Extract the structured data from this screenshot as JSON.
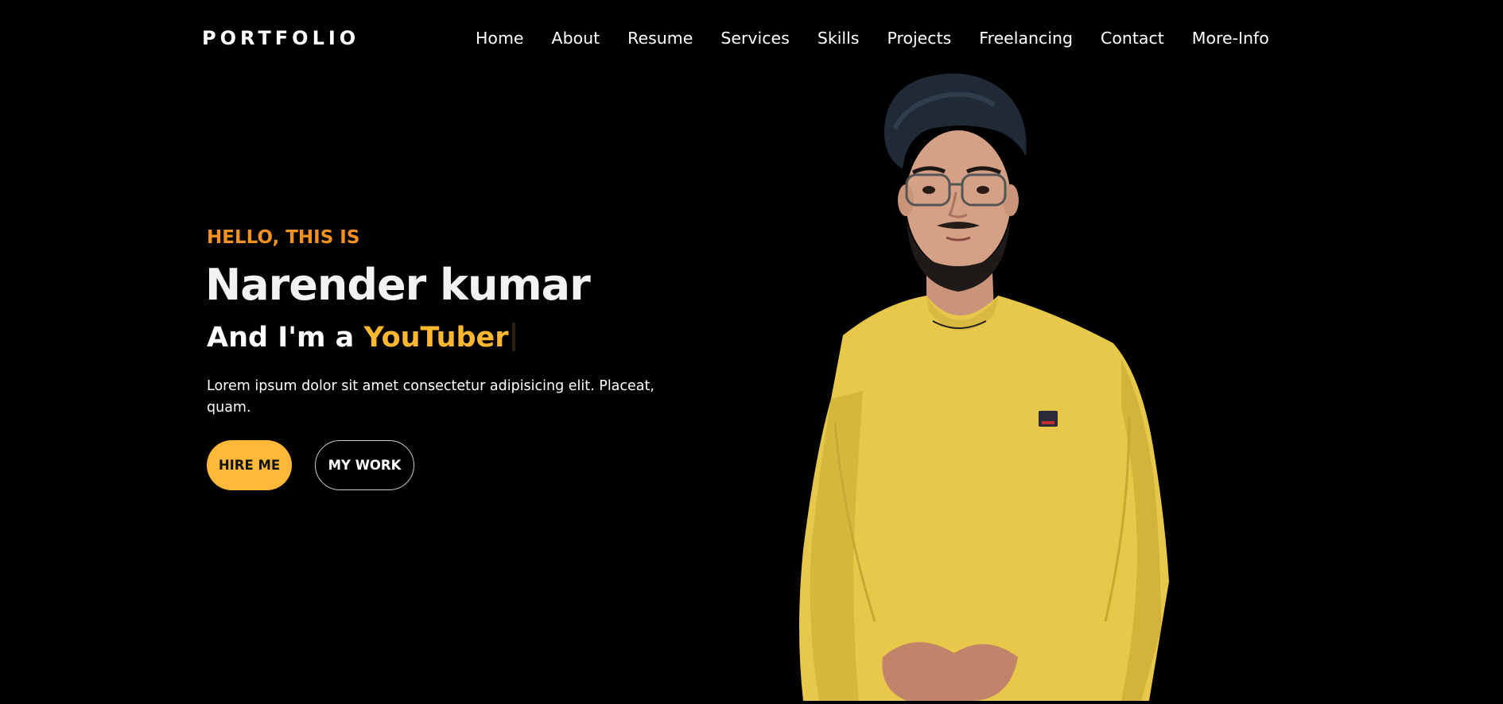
{
  "navbar": {
    "logo": "PORTFOLIO",
    "links": [
      "Home",
      "About",
      "Resume",
      "Services",
      "Skills",
      "Projects",
      "Freelancing",
      "Contact",
      "More-Info"
    ]
  },
  "hero": {
    "greeting": "HELLO, THIS IS",
    "name": "Narender kumar",
    "role_prefix": "And I'm a ",
    "role": "YouTuber",
    "description": "Lorem ipsum dolor sit amet consectetur adipisicing elit. Placeat, quam.",
    "hire_button": "HIRE ME",
    "work_button": "MY WORK"
  },
  "colors": {
    "background": "#000000",
    "accent_orange": "#f5921e",
    "accent_yellow": "#ffb838",
    "shirt_yellow": "#e8c84a"
  },
  "icons": {
    "portrait": "person-photo"
  }
}
